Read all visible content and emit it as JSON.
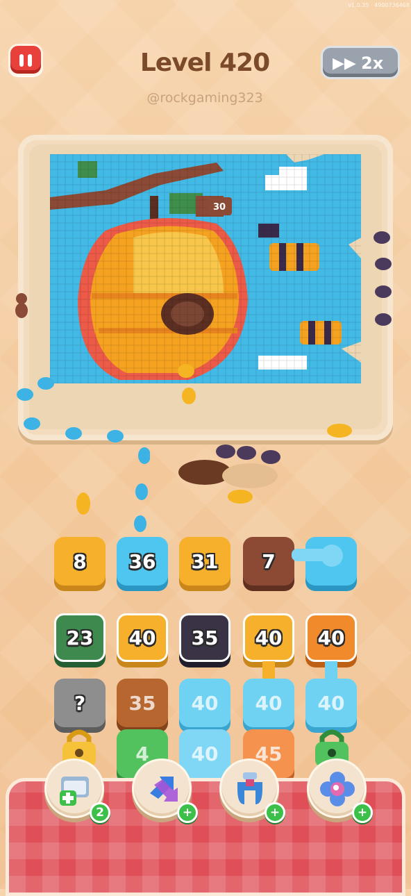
{
  "top_bar": {
    "level_title": "Level 420",
    "handle": "@rockgaming323",
    "version_text": "v1.0.35 · 4900736468",
    "speed_label": "2x",
    "pause_icon": "pause-icon",
    "speed_icon": "fast-forward-icon"
  },
  "board": {
    "bee_counter": "30"
  },
  "queue": [
    {
      "value": "8",
      "color": "#f6b02c",
      "dark": "#c9861a"
    },
    {
      "value": "36",
      "color": "#4ec6ef",
      "dark": "#2b96c2"
    },
    {
      "value": "31",
      "color": "#f6b02c",
      "dark": "#c9861a"
    },
    {
      "value": "7",
      "color": "#8c4a35",
      "dark": "#5f2f20"
    },
    {
      "value": "",
      "color": "#4ec6ef",
      "dark": "#2b96c2"
    }
  ],
  "grid": {
    "row1": [
      {
        "value": "23",
        "color": "#3e8a4e",
        "dark": "#255e32"
      },
      {
        "value": "40",
        "color": "#f6b02c",
        "dark": "#c9861a"
      },
      {
        "value": "35",
        "color": "#3a3346",
        "dark": "#221d2b"
      },
      {
        "value": "40",
        "color": "#f6b02c",
        "dark": "#c9861a"
      },
      {
        "value": "40",
        "color": "#f08a2b",
        "dark": "#bd5f14"
      }
    ],
    "row2": [
      {
        "value": "?",
        "color": "#8e8e8e",
        "dark": "#5d5d5d"
      },
      {
        "value": "35",
        "color": "#b86630",
        "dark": "#84431b"
      },
      {
        "value": "40",
        "color": "#6fd2f3",
        "dark": "#3aa6cf"
      },
      {
        "value": "40",
        "color": "#6fd2f3",
        "dark": "#3aa6cf"
      },
      {
        "value": "40",
        "color": "#6fd2f3",
        "dark": "#3aa6cf"
      }
    ],
    "row3": [
      {
        "value": "",
        "color": "#f6c23a",
        "dark": "#c9921a"
      },
      {
        "value": "4",
        "color": "#52c25e",
        "dark": "#2f8d3b"
      },
      {
        "value": "40",
        "color": "#7fd6f5",
        "dark": "#3aa6cf"
      },
      {
        "value": "45",
        "color": "#f5934e",
        "dark": "#c2642a"
      },
      {
        "value": "",
        "color": "#52c25e",
        "dark": "#2f8d3b"
      }
    ]
  },
  "boosters": [
    {
      "name": "add-slot",
      "icon": "add-tray-icon",
      "badge": "2"
    },
    {
      "name": "swap",
      "icon": "swap-arrows-icon",
      "badge": "+"
    },
    {
      "name": "magnet",
      "icon": "magnet-icon",
      "badge": "+"
    },
    {
      "name": "flower",
      "icon": "flower-icon",
      "badge": "+"
    }
  ]
}
